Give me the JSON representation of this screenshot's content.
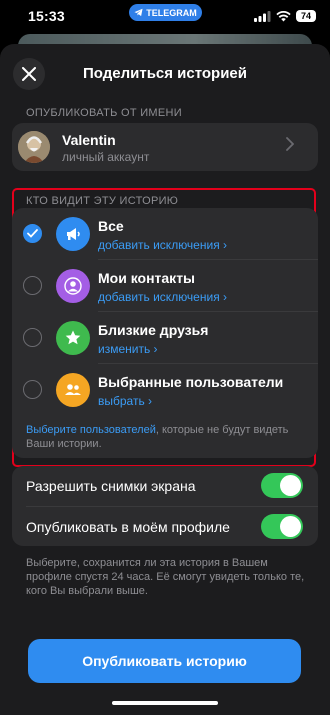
{
  "status_bar": {
    "time": "15:33",
    "app_pill": "TELEGRAM",
    "battery": "74"
  },
  "header": {
    "title": "Поделиться историей"
  },
  "publish_as": {
    "section_label": "ОПУБЛИКОВАТЬ ОТ ИМЕНИ",
    "name": "Valentin",
    "subtitle": "личный аккаунт"
  },
  "audience": {
    "section_label": "КТО ВИДИТ ЭТУ ИСТОРИЮ",
    "options": [
      {
        "name": "Все",
        "link": "добавить исключения ›",
        "selected": true,
        "icon": "megaphone-icon",
        "color": "#2f8cf0"
      },
      {
        "name": "Мои контакты",
        "link": "добавить исключения ›",
        "selected": false,
        "icon": "person-icon",
        "color": "#a45ee5"
      },
      {
        "name": "Близкие друзья",
        "link": "изменить ›",
        "selected": false,
        "icon": "star-icon",
        "color": "#3fba4e"
      },
      {
        "name": "Выбранные пользователи",
        "link": "выбрать ›",
        "selected": false,
        "icon": "people-icon",
        "color": "#f5a623"
      }
    ],
    "footnote_link": "Выберите пользователей",
    "footnote_text": ", которые не будут видеть Ваши истории."
  },
  "settings": {
    "allow_screenshots": {
      "label": "Разрешить снимки экрана",
      "on": true
    },
    "post_to_profile": {
      "label": "Опубликовать в моём профиле",
      "on": true
    },
    "footnote": "Выберите, сохранится ли эта история в Вашем профиле спустя 24 часа. Её смогут увидеть только те, кого Вы выбрали выше."
  },
  "publish_button": "Опубликовать историю"
}
